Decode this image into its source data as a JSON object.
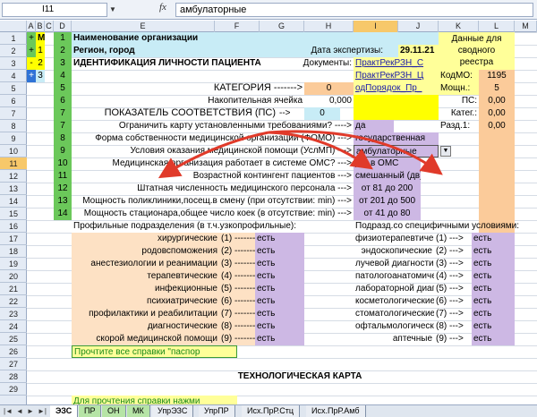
{
  "formula_bar": {
    "cell_ref": "I11",
    "fx": "fx",
    "value": "амбулаторные"
  },
  "columns": [
    "A",
    "B",
    "C",
    "D",
    "E",
    "F",
    "G",
    "H",
    "I",
    "J",
    "K",
    "L",
    "M"
  ],
  "rows": [
    "1",
    "2",
    "3",
    "4",
    "5",
    "6",
    "7",
    "8",
    "9",
    "10",
    "11",
    "12",
    "13",
    "14",
    "15",
    "16",
    "17",
    "18",
    "19",
    "20",
    "21",
    "22",
    "23",
    "24",
    "25",
    "26",
    "27",
    "28",
    "29"
  ],
  "outline": {
    "plus": "+",
    "minus": "-",
    "mo": "МО",
    "n1": "1",
    "n2": "2",
    "n3": "3"
  },
  "header": {
    "org_name": "Наименование организации",
    "region": "Регион, город",
    "title": "ИДЕНТИФИКАЦИЯ ЛИЧНОСТИ ПАЦИЕНТА",
    "exam_date_label": "Дата экспертизы:",
    "exam_date": "29.11.21",
    "documents_label": "Документы:",
    "doc1": "ПрактРекРЗН_С",
    "doc2": "ПрактРекРЗН_Ц",
    "doc3": "одПорядок_Пр_",
    "summary_label": "Данные для сводного реестра",
    "kod_mo_label": "КодМО:",
    "kod_mo": "1195",
    "moshch_label": "Мощн.:",
    "moshch": "5",
    "ps_label": "ПС:",
    "ps": "0,00",
    "kateg_label": "Катег.:",
    "kateg": "0,00",
    "razd_label": "Разд.1:",
    "razd": "0,00"
  },
  "fields": {
    "category_label": "КАТЕГОРИЯ ------->",
    "category": "0",
    "accum_label": "Накопительная ячейка",
    "accum": "0,000",
    "ps_label": "ПОКАЗАТЕЛЬ СООТВЕТСТВИЯ (ПС)",
    "ps_arrow": "-->",
    "ps": "0"
  },
  "rows_info": [
    {
      "n": "7",
      "label": "Ограничить карту установленными требованиями? ---->",
      "value": "да"
    },
    {
      "n": "8",
      "label": "Форма собственности медицинской организации (ФОМО) --->",
      "value": "государственная"
    },
    {
      "n": "9",
      "label": "Условия оказания медицинской помощи (УслМП) --->",
      "value": "амбулаторные"
    },
    {
      "n": "10",
      "label": "Медицинская организация работает в системе ОМС? --->",
      "value": "да, в ОМС"
    },
    {
      "n": "11",
      "label": "Возрастной контингент пациентов --->",
      "value": "смешанный (дв)"
    },
    {
      "n": "12",
      "label": "Штатная численность медицинского персонала --->",
      "value": "от 81 до 200"
    },
    {
      "n": "13",
      "label": "Мощность поликлиники,посещ.в смену (при отсутствии: min) --->",
      "value": "от 201 до 500"
    },
    {
      "n": "14",
      "label": "Мощность стационара,общее число коек (в отсутствие: min) --->",
      "value": "от 41 до 80"
    }
  ],
  "profile_header": "Профильные подразделения (в т.ч.узкопрофильные):",
  "special_header": "Подразд.со специфичными условиями:",
  "profiles": [
    {
      "label": "хирургические",
      "n": "(1) ------->",
      "value": "есть"
    },
    {
      "label": "родовспоможения",
      "n": "(2) ------->",
      "value": "есть"
    },
    {
      "label": "анестезиологии и реанимации",
      "n": "(3) ------->",
      "value": "есть"
    },
    {
      "label": "терапевтические",
      "n": "(4) ------->",
      "value": "есть"
    },
    {
      "label": "инфекционные",
      "n": "(5) ------->",
      "value": "есть"
    },
    {
      "label": "психиатрические",
      "n": "(6) ------->",
      "value": "есть"
    },
    {
      "label": "профилактики и реабилитации",
      "n": "(7) ------->",
      "value": "есть"
    },
    {
      "label": "диагностические",
      "n": "(8) ------->",
      "value": "есть"
    },
    {
      "label": "скорой медицинской помощи",
      "n": "(9) ------->",
      "value": "есть"
    }
  ],
  "specials": [
    {
      "label": "физиотерапевтические",
      "n": "(1) --->",
      "value": "есть"
    },
    {
      "label": "эндоскопические",
      "n": "(2) --->",
      "value": "есть"
    },
    {
      "label": "лучевой диагностики",
      "n": "(3) --->",
      "value": "есть"
    },
    {
      "label": "патологоанатомические",
      "n": "(4) --->",
      "value": "есть"
    },
    {
      "label": "лабораторной диагностики",
      "n": "(5) --->",
      "value": "есть"
    },
    {
      "label": "косметологические",
      "n": "(6) --->",
      "value": "есть"
    },
    {
      "label": "стоматологические",
      "n": "(7) --->",
      "value": "есть"
    },
    {
      "label": "офтальмологические",
      "n": "(8) --->",
      "value": "есть"
    },
    {
      "label": "аптечные",
      "n": "(9) --->",
      "value": "есть"
    }
  ],
  "read_note": "Прочтите все справки \"паспор",
  "tech_card": "ТЕХНОЛОГИЧЕСКАЯ КАРТА",
  "bottom_note": "Для прочтения справки нажми",
  "tabs": [
    "ЭЗС",
    "ПР",
    "ОН",
    "МК",
    "УпрЭЗС",
    "УпрПР",
    "Исх.ПрР.Стц",
    "Исх.ПрР.Амб"
  ],
  "active_tab": "ЭЗС",
  "colors": {
    "accent_orange": "#fbcb9a",
    "lavender": "#cdb8e4",
    "arrow_red": "#e03a2a",
    "sel_header": "#f7c86a"
  }
}
